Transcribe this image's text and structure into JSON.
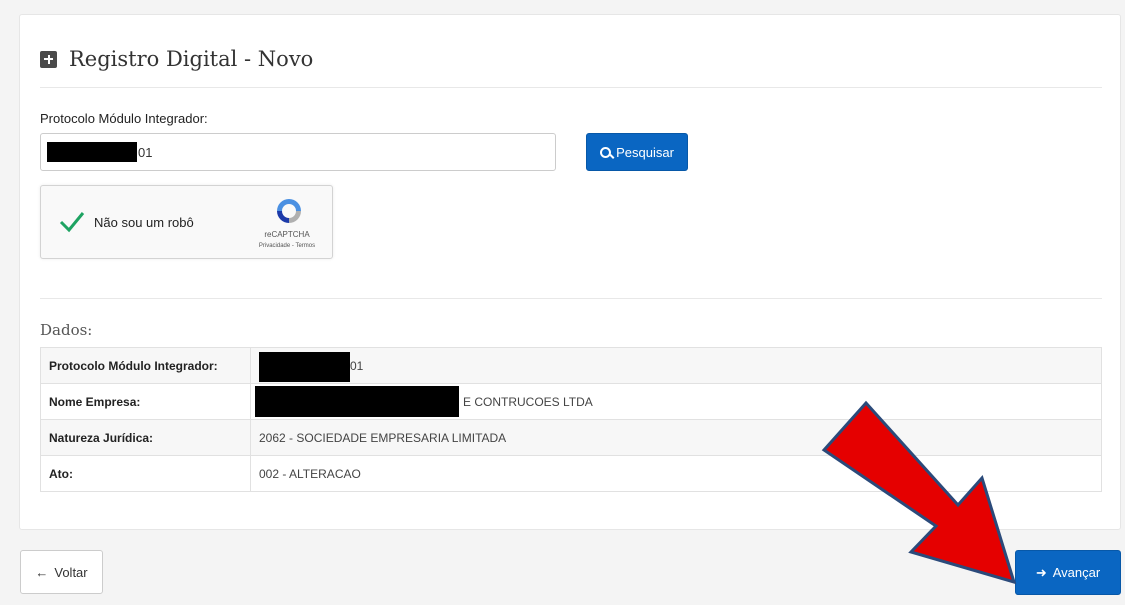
{
  "header": {
    "title": "Registro Digital - Novo",
    "icon": "plus-square-icon"
  },
  "search": {
    "label": "Protocolo Módulo Integrador:",
    "visible_value_suffix": "01",
    "button_label": "Pesquisar"
  },
  "captcha": {
    "label": "Não sou um robô",
    "brand": "reCAPTCHA",
    "links": "Privacidade - Termos",
    "checked": true
  },
  "dados": {
    "heading": "Dados:",
    "rows": [
      {
        "key": "Protocolo Módulo Integrador:",
        "value": "01",
        "redacted": true
      },
      {
        "key": "Nome Empresa:",
        "value": "E CONTRUCOES LTDA",
        "redacted": true
      },
      {
        "key": "Natureza Jurídica:",
        "value": "2062 - SOCIEDADE EMPRESARIA LIMITADA",
        "redacted": false
      },
      {
        "key": "Ato:",
        "value": "002 - ALTERACAO",
        "redacted": false
      }
    ]
  },
  "footer": {
    "back_label": "Voltar",
    "next_label": "Avançar"
  },
  "colors": {
    "primary": "#0a66c2",
    "callout_arrow": "#e50000"
  }
}
